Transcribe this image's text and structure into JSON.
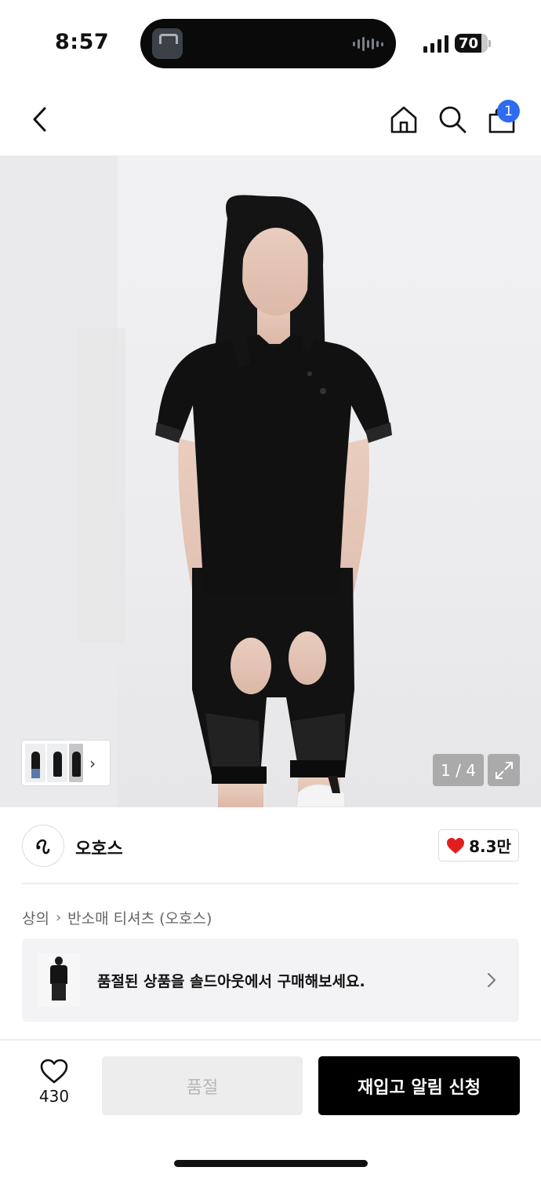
{
  "status_bar": {
    "time": "8:57",
    "battery": "70"
  },
  "nav": {
    "cart_count": "1"
  },
  "gallery": {
    "page_indicator": "1 / 4"
  },
  "brand": {
    "name": "오호스",
    "like_count": "8.3만"
  },
  "breadcrumb": {
    "category": "상의",
    "subcategory": "반소매 티셔츠 (오호스)"
  },
  "banner": {
    "text": "품절된 상품을 솔드아웃에서 구매해보세요."
  },
  "actions": {
    "wish_count": "430",
    "soldout_label": "품절",
    "restock_label": "재입고 알림 신청"
  },
  "colors": {
    "badge": "#2d6cf0",
    "heart": "#e21d1d",
    "primary_button": "#000000",
    "disabled_button": "#ededed"
  },
  "icons": [
    "back-chevron-icon",
    "home-icon",
    "search-icon",
    "shopping-bag-icon",
    "expand-icon",
    "heart-icon",
    "chevron-right-icon"
  ]
}
